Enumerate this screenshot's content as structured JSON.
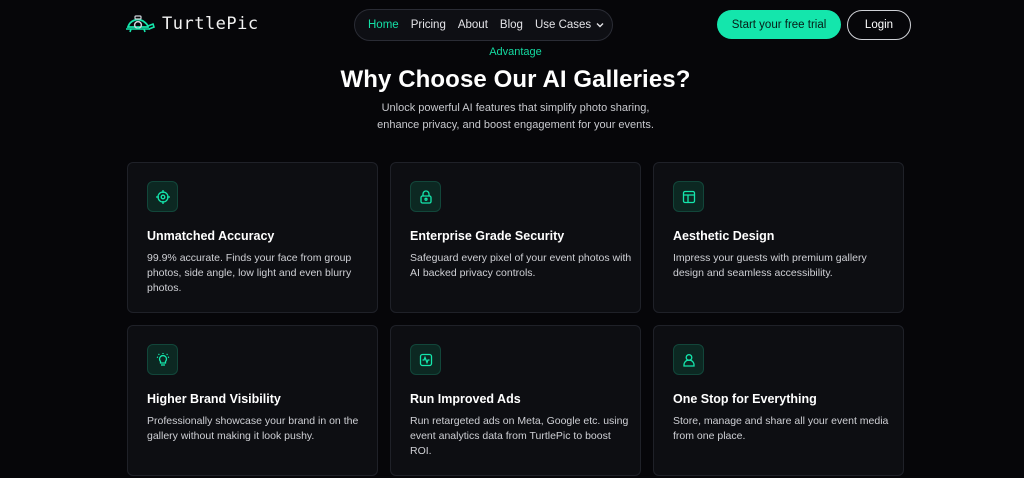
{
  "brand": {
    "name": "TurtlePic"
  },
  "colors": {
    "accent": "#14e6ac",
    "background": "#060609",
    "card": "#0d0e12"
  },
  "nav": {
    "items": [
      {
        "label": "Home",
        "active": true
      },
      {
        "label": "Pricing",
        "active": false
      },
      {
        "label": "About",
        "active": false
      },
      {
        "label": "Blog",
        "active": false
      },
      {
        "label": "Use Cases",
        "active": false,
        "dropdown": true
      }
    ],
    "cta_label": "Start your free trial",
    "login_label": "Login"
  },
  "section": {
    "eyebrow": "Advantage",
    "title": "Why Choose Our AI Galleries?",
    "subtitle_lines": [
      "Unlock powerful AI features that simplify photo sharing,",
      "enhance privacy, and boost engagement for your events."
    ]
  },
  "features": [
    {
      "icon": "target-icon",
      "title": "Unmatched Accuracy",
      "description": "99.9% accurate. Finds your face from group photos, side angle, low light and even blurry photos."
    },
    {
      "icon": "lock-icon",
      "title": "Enterprise Grade Security",
      "description": "Safeguard every pixel of your event photos with AI backed privacy controls."
    },
    {
      "icon": "layout-icon",
      "title": "Aesthetic Design",
      "description": "Impress your guests with premium gallery design and seamless accessibility."
    },
    {
      "icon": "lightbulb-icon",
      "title": "Higher Brand Visibility",
      "description": "Professionally showcase your brand in on the gallery without making it look pushy."
    },
    {
      "icon": "activity-icon",
      "title": "Run Improved Ads",
      "description": "Run retargeted ads on Meta, Google etc. using event analytics data from TurtlePic to boost ROI."
    },
    {
      "icon": "user-icon",
      "title": "One Stop for Everything",
      "description": "Store, manage and share all your event media from one place."
    }
  ]
}
